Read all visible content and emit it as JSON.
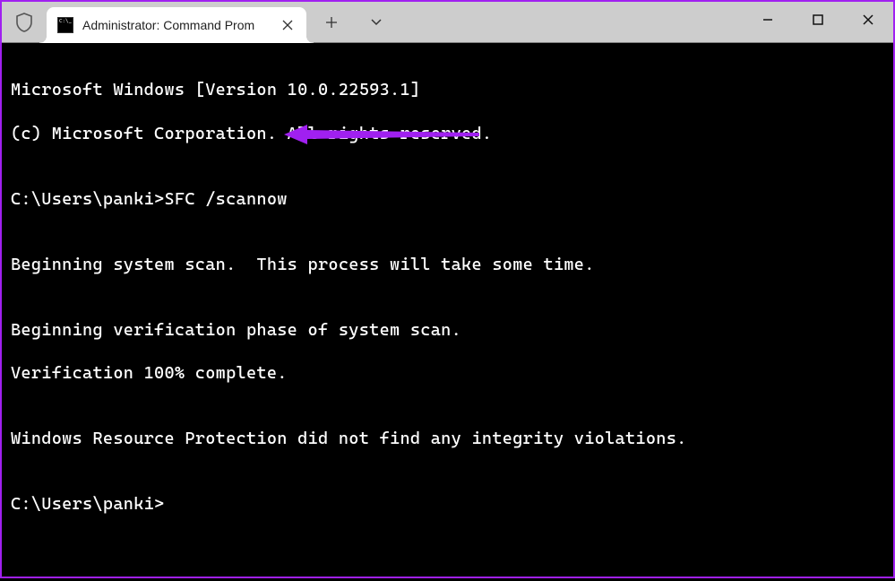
{
  "titlebar": {
    "tab_title": "Administrator: Command Prom",
    "new_tab_label": "+",
    "tab_menu_label": "v"
  },
  "window_controls": {
    "minimize": "minimize",
    "maximize": "maximize",
    "close": "close"
  },
  "terminal": {
    "lines": {
      "l1": "Microsoft Windows [Version 10.0.22593.1]",
      "l2": "(c) Microsoft Corporation. All rights reserved.",
      "l3": "",
      "l4_prompt": "C:\\Users\\panki>",
      "l4_cmd": "SFC /scannow",
      "l5": "",
      "l6": "Beginning system scan.  This process will take some time.",
      "l7": "",
      "l8": "Beginning verification phase of system scan.",
      "l9": "Verification 100% complete.",
      "l10": "",
      "l11": "Windows Resource Protection did not find any integrity violations.",
      "l12": "",
      "l13": "C:\\Users\\panki>"
    }
  },
  "annotation": {
    "color": "#a020f0"
  }
}
